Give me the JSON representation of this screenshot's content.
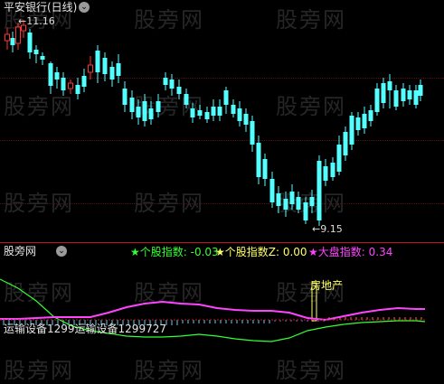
{
  "top_panel": {
    "title": "平安银行(日线)",
    "collapse_icon": "chevron-down-icon",
    "high_label": "←11.16",
    "low_label": "←9.15",
    "up_color": "#ff3232",
    "down_color": "#54ffff"
  },
  "bottom_panel": {
    "title": "股旁网",
    "collapse_icon": "chevron-down-icon",
    "indicator1": {
      "label": "★个股指数: -0.03",
      "color": "#33ff33"
    },
    "indicator2": {
      "label": "★个股指数Z: 0.00",
      "color": "#ffff66"
    },
    "indicator3": {
      "label": "★大盘指数: 0.34",
      "color": "#ff44ff"
    },
    "sector_label": "房地产",
    "sector_code_label": "运输设备1299运输设备1299727"
  },
  "watermark": "股旁网"
}
